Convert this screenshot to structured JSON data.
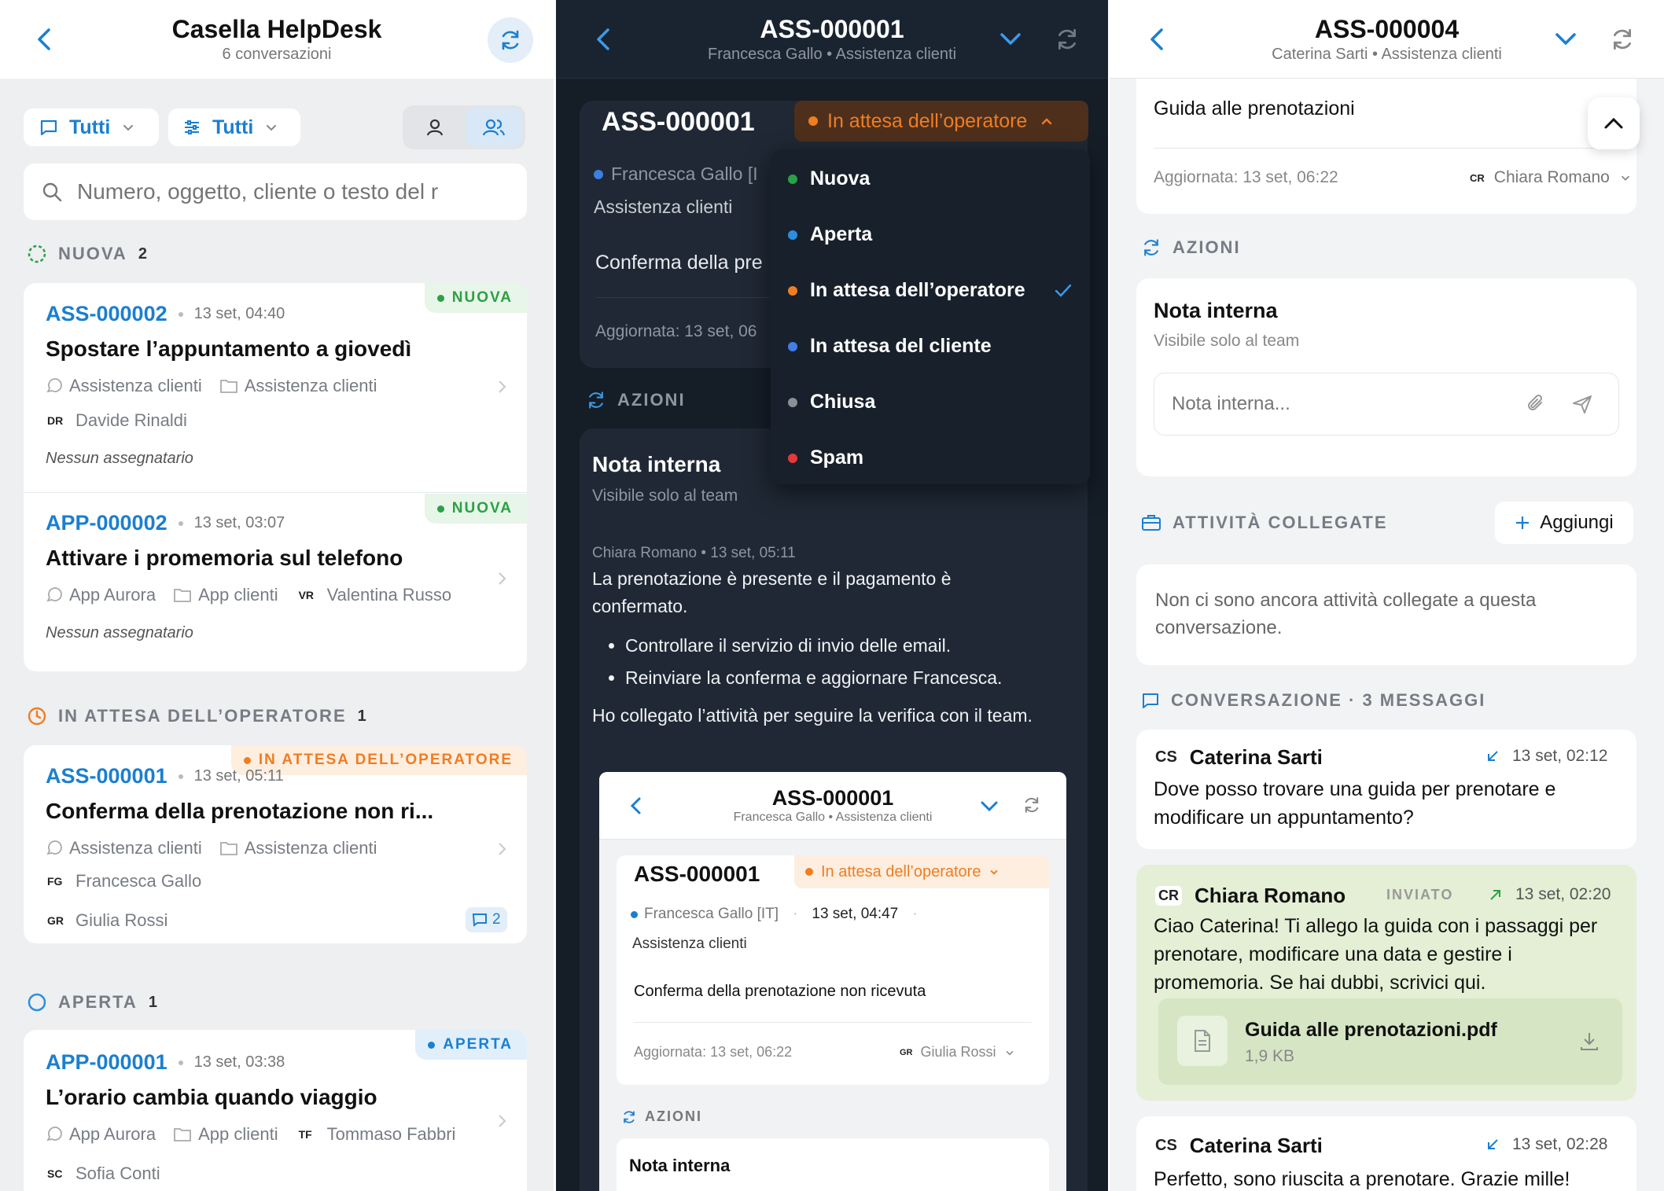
{
  "colors": {
    "blue": "#1a7fd0",
    "green": "#2aa145",
    "orange": "#ef7d22",
    "red": "#e4393b",
    "gray": "#7b818a",
    "dark_bg": "#151d27",
    "green_bubble": "#e4efd5"
  },
  "left": {
    "title": "Casella HelpDesk",
    "subtitle": "6 conversazioni",
    "filter_channels": "Tutti",
    "filter_status": "Tutti",
    "search_placeholder": "Numero, oggetto, cliente o testo del r",
    "sections": {
      "nuova": {
        "label": "NUOVA",
        "count": "2"
      },
      "attesa": {
        "label": "IN ATTESA DELL’OPERATORE",
        "count": "1"
      },
      "aperta": {
        "label": "APERTA",
        "count": "1"
      }
    },
    "tickets": [
      {
        "id": "ASS-000002",
        "time": "13 set, 04:40",
        "title": "Spostare l’appuntamento a giovedì",
        "channel": "Assistenza clienti",
        "queue": "Assistenza clienti",
        "customer_initials": "DR",
        "customer": "Davide Rinaldi",
        "assignee": "Nessun assegnatario",
        "badge": "NUOVA"
      },
      {
        "id": "APP-000002",
        "time": "13 set, 03:07",
        "title": "Attivare i promemoria sul telefono",
        "channel": "App Aurora",
        "queue": "App clienti",
        "customer_initials": "VR",
        "customer": "Valentina Russo",
        "assignee": "Nessun assegnatario",
        "badge": "NUOVA"
      },
      {
        "id": "ASS-000001",
        "time": "13 set, 05:11",
        "title": "Conferma della prenotazione non ri...",
        "channel": "Assistenza clienti",
        "queue": "Assistenza clienti",
        "customer_initials": "FG",
        "customer": "Francesca Gallo",
        "assignee_initials": "GR",
        "assignee": "Giulia Rossi",
        "comments": "2",
        "badge": "IN ATTESA DELL’OPERATORE"
      },
      {
        "id": "APP-000001",
        "time": "13 set, 03:38",
        "title": "L’orario cambia quando viaggio",
        "channel": "App Aurora",
        "queue": "App clienti",
        "customer_initials": "TF",
        "customer": "Tommaso Fabbri",
        "assignee_initials": "SC",
        "assignee": "Sofia Conti",
        "badge": "APERTA"
      }
    ]
  },
  "middle": {
    "title": "ASS-000001",
    "subtitle": "Francesca Gallo • Assistenza clienti",
    "card_id": "ASS-000001",
    "status": "In attesa dell’operatore",
    "customer": "Francesca Gallo [I",
    "channel": "Assistenza clienti",
    "subject": "Conferma della pre",
    "updated": "Aggiornata: 13 set, 06",
    "status_menu": [
      {
        "label": "Nuova",
        "color": "#2aa145"
      },
      {
        "label": "Aperta",
        "color": "#2b8fe0"
      },
      {
        "label": "In attesa dell’operatore",
        "color": "#ef7d22",
        "checked": true
      },
      {
        "label": "In attesa del cliente",
        "color": "#3f7fe6"
      },
      {
        "label": "Chiusa",
        "color": "#8b9098"
      },
      {
        "label": "Spam",
        "color": "#e4393b"
      }
    ],
    "actions_label": "AZIONI",
    "note_title": "Nota interna",
    "note_subtitle": "Visibile solo al team",
    "note_meta": "Chiara Romano • 13 set, 05:11",
    "note_text": "La prenotazione è presente e il pagamento è confermato.",
    "note_bullets": [
      "Controllare il servizio di invio delle email.",
      "Reinviare la conferma e aggiornare Francesca."
    ],
    "note_footer": "Ho collegato l’attività per seguire la verifica con il team.",
    "embedded": {
      "title": "ASS-000001",
      "subtitle": "Francesca Gallo • Assistenza clienti",
      "card_id": "ASS-000001",
      "status": "In attesa dell’operatore",
      "customer": "Francesca Gallo [IT]",
      "date": "13 set, 04:47",
      "channel": "Assistenza clienti",
      "subject": "Conferma della prenotazione non ricevuta",
      "updated": "Aggiornata: 13 set, 06:22",
      "assignee_initials": "GR",
      "assignee": "Giulia Rossi",
      "actions_label": "AZIONI",
      "note_title": "Nota interna"
    }
  },
  "right": {
    "title": "ASS-000004",
    "subtitle": "Caterina Sarti • Assistenza clienti",
    "subject": "Guida alle prenotazioni",
    "updated": "Aggiornata: 13 set, 06:22",
    "assignee_initials": "CR",
    "assignee": "Chiara Romano",
    "actions_label": "AZIONI",
    "note_title": "Nota interna",
    "note_subtitle": "Visibile solo al team",
    "note_placeholder": "Nota interna...",
    "tasks_label": "ATTIVITÀ COLLEGATE",
    "add_label": "Aggiungi",
    "tasks_empty": "Non ci sono ancora attività collegate a questa conversazione.",
    "conversation_label": "CONVERSAZIONE · 3 MESSAGGI",
    "messages": [
      {
        "initials": "CS",
        "author": "Caterina Sarti",
        "time": "13 set, 02:12",
        "text": "Dove posso trovare una guida per prenotare e modificare un appuntamento?"
      },
      {
        "initials": "CR",
        "author": "Chiara Romano",
        "tag": "INVIATO",
        "time": "13 set, 02:20",
        "text": "Ciao Caterina! Ti allego la guida con i passaggi per prenotare, modificare una data e gestire i promemoria. Se hai dubbi, scrivici qui.",
        "attachment": {
          "name": "Guida alle prenotazioni.pdf",
          "size": "1,9 KB"
        }
      },
      {
        "initials": "CS",
        "author": "Caterina Sarti",
        "time": "13 set, 02:28",
        "text": "Perfetto, sono riuscita a prenotare. Grazie mille!"
      }
    ]
  }
}
